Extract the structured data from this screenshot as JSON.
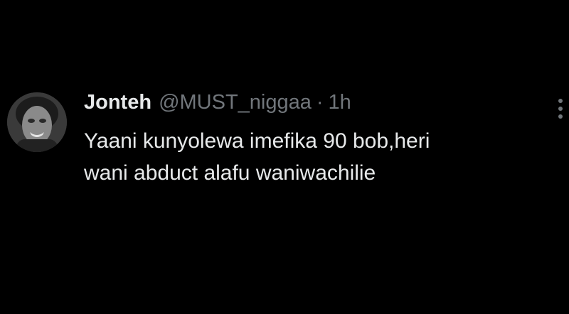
{
  "tweet": {
    "author": {
      "display_name": "Jonteh",
      "handle": "@MUST_niggaa",
      "avatar_icon": "user-avatar-photo"
    },
    "separator": "·",
    "time": "1h",
    "text_lines": [
      "Yaani kunyolewa imefika 90 bob,heri",
      "wani abduct alafu waniwachilie"
    ],
    "more_icon": "more-options-icon"
  },
  "colors": {
    "background": "#000000",
    "primary_text": "#e7e9ea",
    "secondary_text": "#71767b"
  }
}
